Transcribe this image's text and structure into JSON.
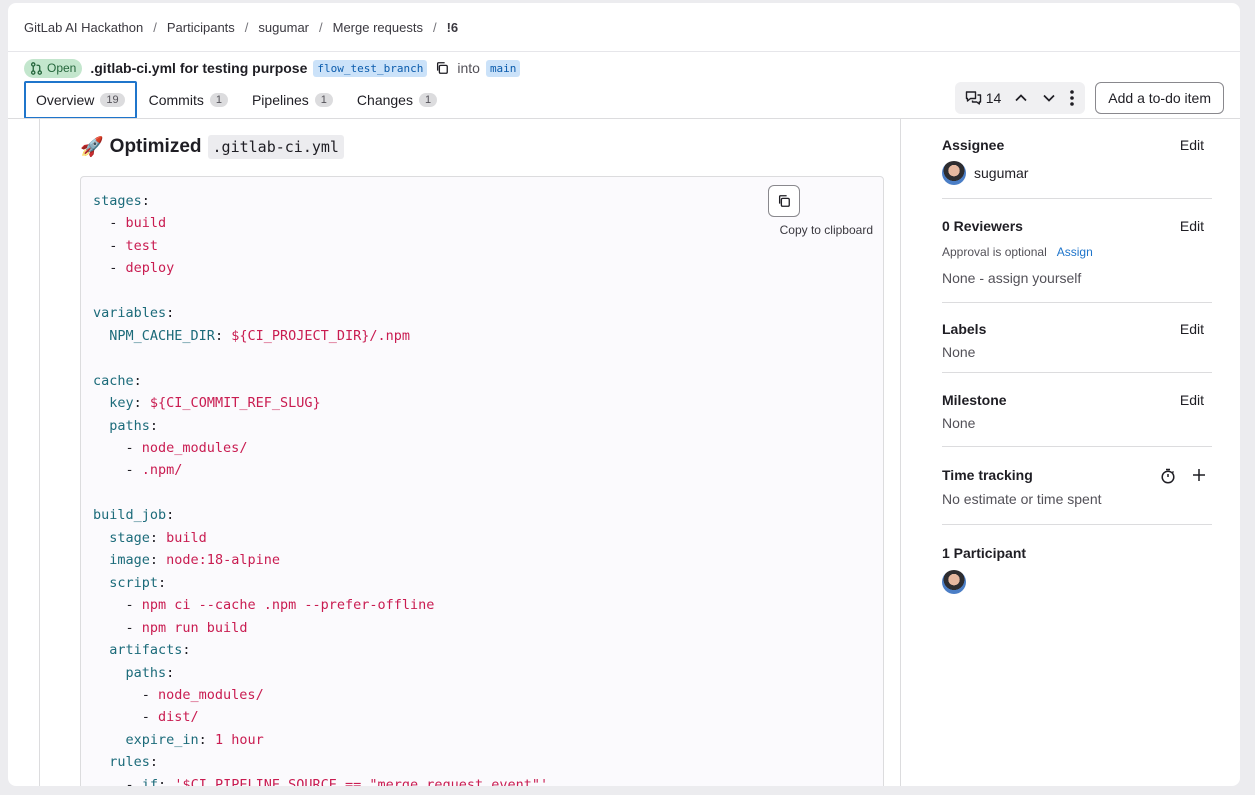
{
  "breadcrumb": {
    "items": [
      "GitLab AI Hackathon",
      "Participants",
      "sugumar",
      "Merge requests"
    ],
    "current": "!6"
  },
  "mr": {
    "status": "Open",
    "title": ".gitlab-ci.yml for testing purpose",
    "source_branch": "flow_test_branch",
    "into_label": "into",
    "target_branch": "main"
  },
  "tabs": [
    {
      "label": "Overview",
      "count": "19"
    },
    {
      "label": "Commits",
      "count": "1"
    },
    {
      "label": "Pipelines",
      "count": "1"
    },
    {
      "label": "Changes",
      "count": "1"
    }
  ],
  "actions": {
    "comments_count": "14",
    "todo_label": "Add a to-do item"
  },
  "content": {
    "heading_emoji": "🚀",
    "heading_text": "Optimized",
    "heading_code": ".gitlab-ci.yml",
    "copy_tooltip": "Copy to clipboard",
    "code_lines": [
      [
        [
          "k",
          "stages"
        ],
        [
          "p",
          ":"
        ]
      ],
      [
        [
          "p",
          "  - "
        ],
        [
          "v",
          "build"
        ]
      ],
      [
        [
          "p",
          "  - "
        ],
        [
          "v",
          "test"
        ]
      ],
      [
        [
          "p",
          "  - "
        ],
        [
          "v",
          "deploy"
        ]
      ],
      [],
      [
        [
          "k",
          "variables"
        ],
        [
          "p",
          ":"
        ]
      ],
      [
        [
          "p",
          "  "
        ],
        [
          "k",
          "NPM_CACHE_DIR"
        ],
        [
          "p",
          ": "
        ],
        [
          "v",
          "${CI_PROJECT_DIR}/.npm"
        ]
      ],
      [],
      [
        [
          "k",
          "cache"
        ],
        [
          "p",
          ":"
        ]
      ],
      [
        [
          "p",
          "  "
        ],
        [
          "k",
          "key"
        ],
        [
          "p",
          ": "
        ],
        [
          "v",
          "${CI_COMMIT_REF_SLUG}"
        ]
      ],
      [
        [
          "p",
          "  "
        ],
        [
          "k",
          "paths"
        ],
        [
          "p",
          ":"
        ]
      ],
      [
        [
          "p",
          "    - "
        ],
        [
          "v",
          "node_modules/"
        ]
      ],
      [
        [
          "p",
          "    - "
        ],
        [
          "v",
          ".npm/"
        ]
      ],
      [],
      [
        [
          "k",
          "build_job"
        ],
        [
          "p",
          ":"
        ]
      ],
      [
        [
          "p",
          "  "
        ],
        [
          "k",
          "stage"
        ],
        [
          "p",
          ": "
        ],
        [
          "v",
          "build"
        ]
      ],
      [
        [
          "p",
          "  "
        ],
        [
          "k",
          "image"
        ],
        [
          "p",
          ": "
        ],
        [
          "v",
          "node:18-alpine"
        ]
      ],
      [
        [
          "p",
          "  "
        ],
        [
          "k",
          "script"
        ],
        [
          "p",
          ":"
        ]
      ],
      [
        [
          "p",
          "    - "
        ],
        [
          "v",
          "npm ci --cache .npm --prefer-offline"
        ]
      ],
      [
        [
          "p",
          "    - "
        ],
        [
          "v",
          "npm run build"
        ]
      ],
      [
        [
          "p",
          "  "
        ],
        [
          "k",
          "artifacts"
        ],
        [
          "p",
          ":"
        ]
      ],
      [
        [
          "p",
          "    "
        ],
        [
          "k",
          "paths"
        ],
        [
          "p",
          ":"
        ]
      ],
      [
        [
          "p",
          "      - "
        ],
        [
          "v",
          "node_modules/"
        ]
      ],
      [
        [
          "p",
          "      - "
        ],
        [
          "v",
          "dist/"
        ]
      ],
      [
        [
          "p",
          "    "
        ],
        [
          "k",
          "expire_in"
        ],
        [
          "p",
          ": "
        ],
        [
          "v",
          "1 hour"
        ]
      ],
      [
        [
          "p",
          "  "
        ],
        [
          "k",
          "rules"
        ],
        [
          "p",
          ":"
        ]
      ],
      [
        [
          "p",
          "    - "
        ],
        [
          "k",
          "if"
        ],
        [
          "p",
          ": "
        ],
        [
          "v",
          "'$CI_PIPELINE_SOURCE == \"merge_request_event\"'"
        ]
      ]
    ]
  },
  "sidebar": {
    "edit_label": "Edit",
    "assignee": {
      "title": "Assignee",
      "name": "sugumar"
    },
    "reviewers": {
      "title": "0 Reviewers",
      "approval": "Approval is optional",
      "assign": "Assign",
      "none": "None - assign yourself"
    },
    "labels": {
      "title": "Labels",
      "value": "None"
    },
    "milestone": {
      "title": "Milestone",
      "value": "None"
    },
    "time_tracking": {
      "title": "Time tracking",
      "value": "No estimate or time spent"
    },
    "participants": {
      "title": "1 Participant"
    }
  },
  "colors": {
    "accent": "#1f75cb",
    "open_badge": "#c3e6cd",
    "yaml_key": "#1c6b7a",
    "yaml_value": "#c91c51"
  }
}
